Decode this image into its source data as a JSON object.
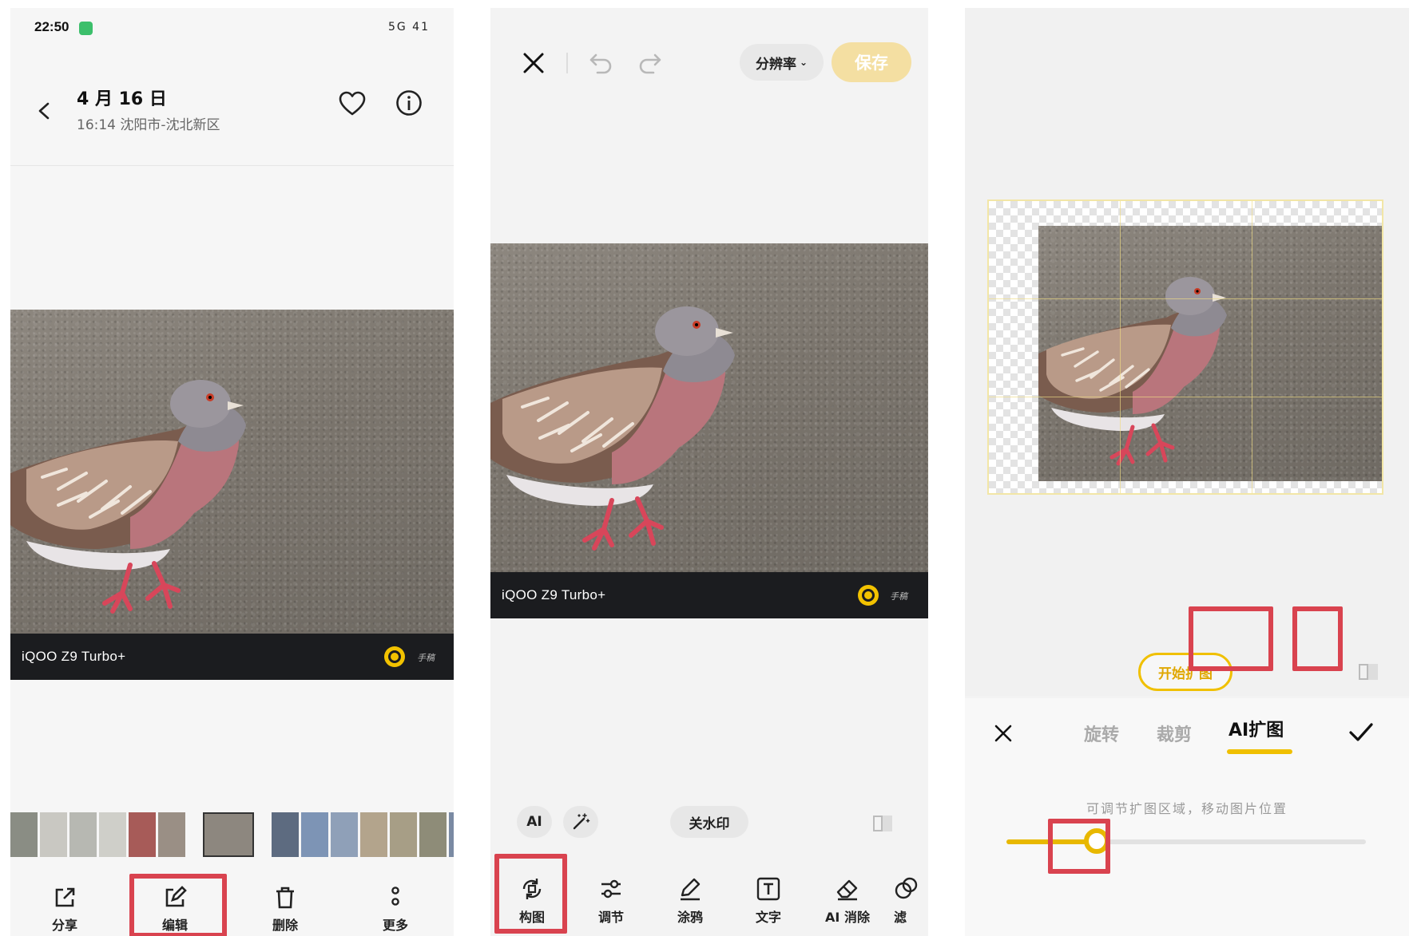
{
  "colors": {
    "accent": "#f0c000",
    "highlight": "#d9434f",
    "brand_bar": "#1b1c1f"
  },
  "screen1": {
    "status_time": "22:50",
    "status_right": "5G 41",
    "header": {
      "date": "4 月 16 日",
      "location": "16:14 沈阳市-沈北新区"
    },
    "brand": "iQOO Z9 Turbo+",
    "signature": "手稿",
    "actions": [
      {
        "label": "分享",
        "icon": "share-icon"
      },
      {
        "label": "编辑",
        "icon": "edit-icon",
        "highlighted": true
      },
      {
        "label": "删除",
        "icon": "trash-icon"
      },
      {
        "label": "更多",
        "icon": "more-icon"
      }
    ]
  },
  "screen2": {
    "resolution_label": "分辨率",
    "save_label": "保存",
    "brand": "iQOO Z9 Turbo+",
    "signature": "手稿",
    "ai_chip": "AI",
    "watermark_chip": "关水印",
    "tools": [
      {
        "label": "构图",
        "icon": "crop-rotate-icon",
        "highlighted": true
      },
      {
        "label": "调节",
        "icon": "adjust-icon"
      },
      {
        "label": "涂鸦",
        "icon": "pen-icon"
      },
      {
        "label": "文字",
        "icon": "text-icon"
      },
      {
        "label": "AI 消除",
        "icon": "eraser-icon"
      },
      {
        "label": "滤",
        "icon": "filter-icon"
      }
    ]
  },
  "screen3": {
    "start_button": "开始扩图",
    "tabs": [
      "旋转",
      "裁剪",
      "AI扩图"
    ],
    "active_tab": "AI扩图",
    "hint": "可调节扩图区域，移动图片位置",
    "slider_value": 0.25
  }
}
